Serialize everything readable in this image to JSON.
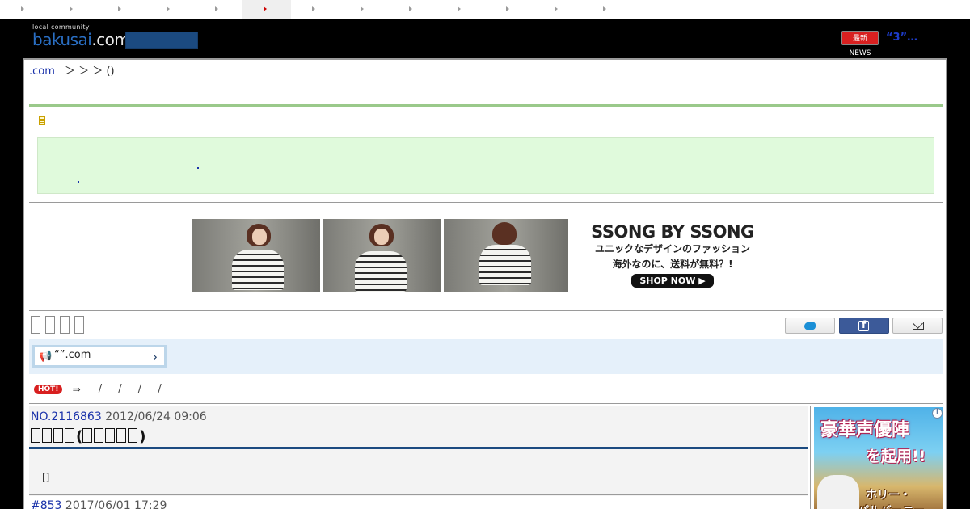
{
  "top_nav": {
    "tab_count": 13,
    "active_index": 5
  },
  "header": {
    "logo_tagline": "local community",
    "logo_name": "bakusai",
    "logo_dot": ".",
    "logo_com": "com",
    "news_badge": "最新NEWS",
    "news_text": "“3”…"
  },
  "breadcrumb": {
    "home_link": ".com",
    "trail": "＞ ＞ ＞ ()"
  },
  "ad_banner": {
    "brand": "SSONG BY SSONG",
    "line1": "ユニックなデザインのファッション",
    "line2": "海外なのに、送料が無料？!",
    "cta": "SHOP NOW ▶"
  },
  "promo": {
    "text": "“”.com",
    "chevron": "›"
  },
  "hot_row": {
    "badge": "HOT!",
    "arrow": "⇒",
    "separators": "/ / / /"
  },
  "post": {
    "number": "NO.2116863",
    "date": "2012/06/24 09:06",
    "title_open": "(",
    "title_close": ")",
    "body": "[]"
  },
  "reply": {
    "number": "#853",
    "date": "2017/06/01 17:29"
  },
  "side_ad": {
    "line1": "豪華声優陣",
    "line2": "を起用!!",
    "line3": "ホリー・",
    "line4": "パルバーニー"
  },
  "colors": {
    "link_blue": "#1a32aa",
    "header_bg": "#000000",
    "notice_green": "#e0fadc",
    "accent_green": "#9ac98a",
    "title_bar_blue": "#1b4a80",
    "hot_red": "#d81f1f"
  }
}
